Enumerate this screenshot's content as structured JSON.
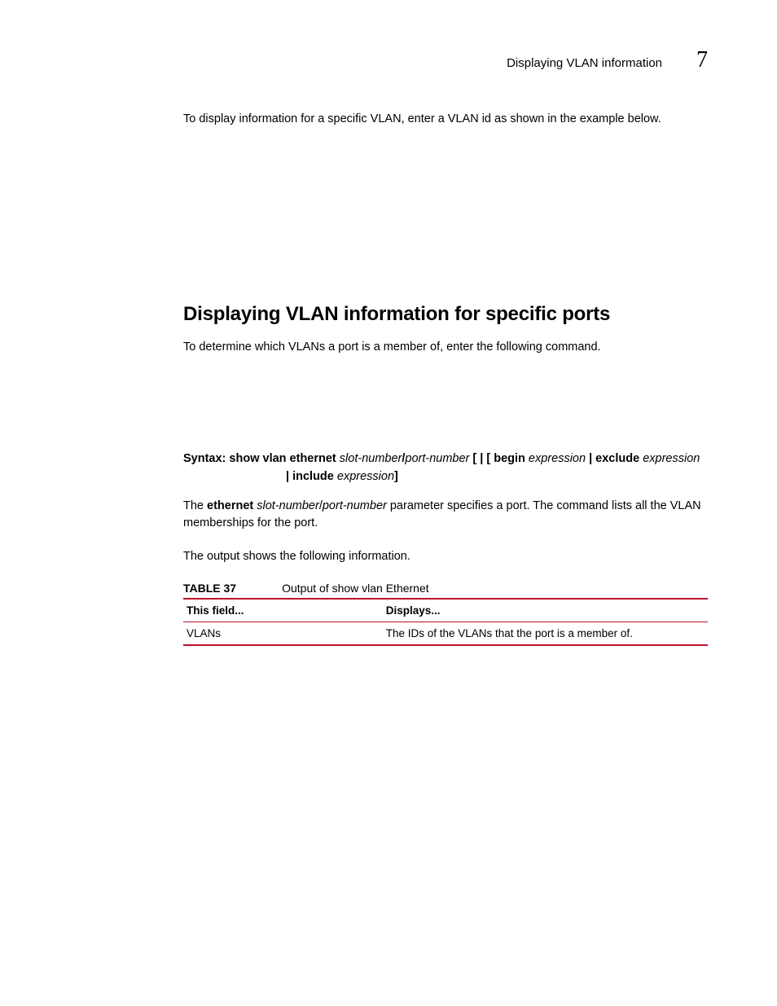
{
  "header": {
    "running_title": "Displaying VLAN information",
    "chapter_number": "7"
  },
  "body": {
    "intro_para": "To display information for a specific VLAN, enter a VLAN id as shown in the example below.",
    "section_heading": "Displaying VLAN information for specific ports",
    "section_para1": "To determine which VLANs a port is a member of, enter the following command.",
    "syntax": {
      "label": "Syntax:",
      "cmd1": "show vlan ethernet",
      "arg1a": "slot-number",
      "sep1": "/",
      "arg1b": "port-number",
      "brackets": " [ | [ ",
      "kw_begin": "begin",
      "expr1": "expression",
      "pipe1": " | ",
      "kw_exclude": "exclude",
      "expr2": "expression",
      "line2_pipe": "| ",
      "kw_include": "include",
      "expr3": "expression",
      "close": "]"
    },
    "para2_pre": "The ",
    "para2_bold": "ethernet",
    "para2_mid": " ",
    "para2_it1": "slot-number",
    "para2_slash": "/",
    "para2_it2": "port-number",
    "para2_post": " parameter specifies a port. The command lists all the VLAN memberships for the port.",
    "para3": "The output shows the following information.",
    "table_caption_num": "TABLE 37",
    "table_caption_title": "Output of show vlan Ethernet",
    "table": {
      "head": {
        "c1": "This field...",
        "c2": "Displays..."
      },
      "rows": [
        {
          "c1": "VLANs",
          "c2": "The IDs of the VLANs that the port is a member of."
        }
      ]
    }
  }
}
